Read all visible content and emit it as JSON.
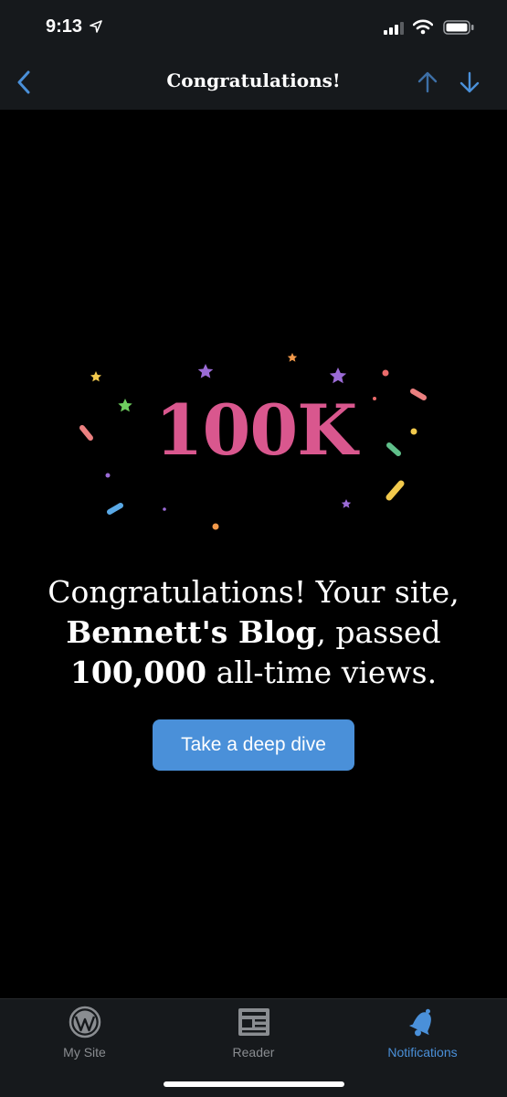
{
  "status_bar": {
    "time": "9:13"
  },
  "nav": {
    "title": "Congratulations!"
  },
  "hero": {
    "badge": "100K"
  },
  "message": {
    "part1": "Congratulations! Your site, ",
    "site_name": "Bennett's Blog",
    "part2": ", passed ",
    "views": "100,000",
    "part3": " all-time views."
  },
  "cta": {
    "label": "Take a deep dive"
  },
  "tab_bar": {
    "items": [
      {
        "label": "My Site",
        "icon": "wordpress-icon",
        "active": false
      },
      {
        "label": "Reader",
        "icon": "reader-icon",
        "active": false
      },
      {
        "label": "Notifications",
        "icon": "bell-icon",
        "active": true
      }
    ]
  },
  "colors": {
    "accent": "#4a90d9",
    "badge": "#d9578e",
    "bar_bg": "#16191c"
  }
}
